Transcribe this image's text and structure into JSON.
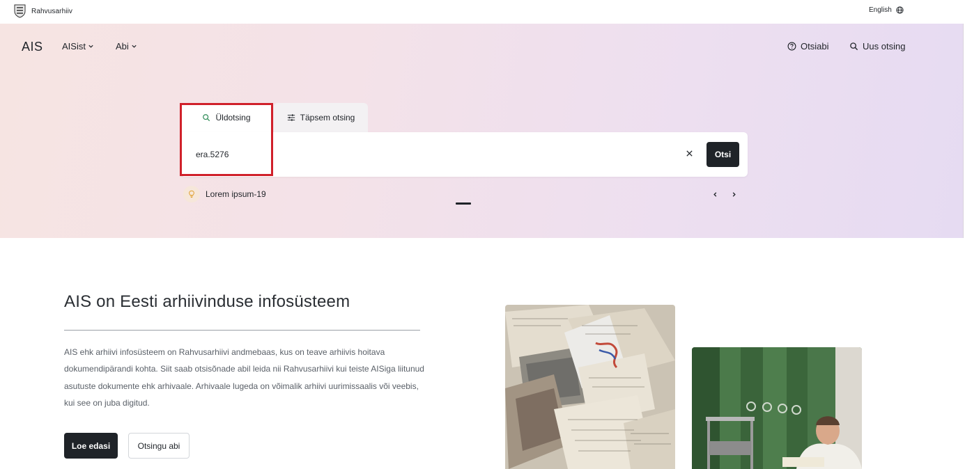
{
  "topbar": {
    "brand_name": "Rahvusarhiiv",
    "language_label": "English"
  },
  "nav": {
    "logo": "AIS",
    "menu_about": "AISist",
    "menu_help": "Abi",
    "search_help": "Otsiabi",
    "new_search": "Uus otsing"
  },
  "search": {
    "tab_general": "Üldotsing",
    "tab_advanced": "Täpsem otsing",
    "query_value": "era.5276",
    "submit_label": "Otsi"
  },
  "tip": {
    "text": "Lorem ipsum-19"
  },
  "content": {
    "heading": "AIS on Eesti arhiivinduse infosüsteem",
    "paragraph": "AIS ehk arhiivi infosüsteem on Rahvusarhiivi andmebaas, kus on teave arhiivis hoitava dokumendipärandi kohta. Siit saab otsisõnade abil leida nii Rahvusarhiivi kui teiste AISiga liitunud asutuste dokumente ehk arhivaale. Arhivaale lugeda on võimalik arhiivi uurimissaalis või veebis, kui see on juba digitud.",
    "read_more": "Loe edasi",
    "search_help_button": "Otsingu abi"
  },
  "icons": {
    "brand": "coat-of-arms-icon",
    "language": "globe-icon",
    "dropdown": "chevron-down-icon",
    "help": "question-circle-icon",
    "search": "search-icon",
    "advanced": "sliders-icon",
    "clear": "close-icon",
    "tip": "lightbulb-icon",
    "prev": "chevron-left-icon",
    "next": "chevron-right-icon"
  },
  "colors": {
    "primary_dark": "#1f2328",
    "highlight_border": "#d0202a",
    "search_icon_green": "#2e8b57"
  }
}
